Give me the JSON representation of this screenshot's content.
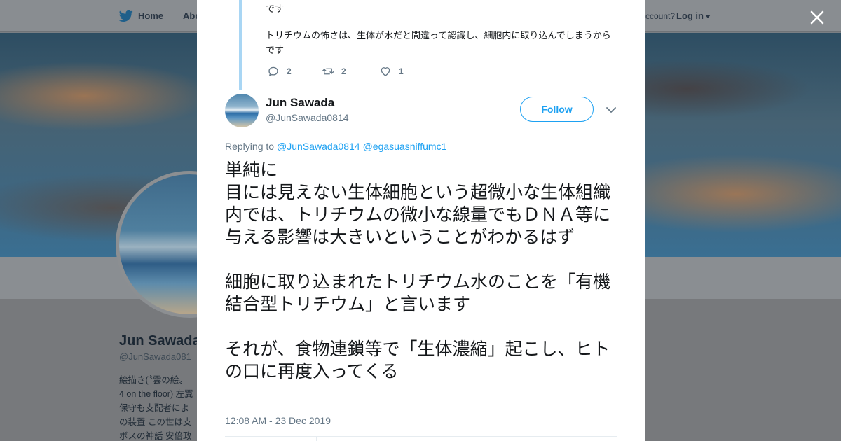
{
  "background": {
    "nav": {
      "home_label": "Home",
      "about_label": "Abo",
      "account_text": "ccount?",
      "login_label": "Log in"
    },
    "profile": {
      "name": "Jun Sawada",
      "handle": "@JunSawada081",
      "bio_lines": [
        "絵描き(〝雲の絵〟",
        "4 on the floor) 左翼",
        "保守も支配者によ",
        "の装置 この世は支",
        "ボスの神話 安倍政"
      ]
    }
  },
  "modal": {
    "parent_tweet": {
      "text_line1": "です",
      "text_para2": "トリチウムの怖さは、生体が水だと間違って認識し、細胞内に取り込んでしまうからです",
      "reply_count": "2",
      "retweet_count": "2",
      "like_count": "1"
    },
    "tweet": {
      "author_name": "Jun Sawada",
      "author_handle": "@JunSawada0814",
      "follow_label": "Follow",
      "replying_prefix": "Replying to",
      "replying_to": [
        "@JunSawada0814",
        "@egasuasniffumc1"
      ],
      "body_lines": [
        "単純に",
        "目には見えない生体細胞という超微小な生体組織内では、トリチウムの微小な線量でもＤＮＡ等に与える影響は大きいということがわかるはず",
        "",
        "細胞に取り込まれたトリチウム水のことを「有機結合型トリチウム」と言います",
        "",
        "それが、食物連鎖等で「生体濃縮」起こし、ヒトの口に再度入ってくる"
      ],
      "timestamp": "12:08 AM - 23 Dec 2019"
    }
  },
  "colors": {
    "accent": "#1da1f2",
    "text": "#14171a",
    "secondary_text": "#657786",
    "thread_line": "#a9d6f4"
  },
  "icons": [
    "twitter-bird-icon",
    "close-icon",
    "reply-icon",
    "retweet-icon",
    "like-icon",
    "chevron-down-icon"
  ]
}
